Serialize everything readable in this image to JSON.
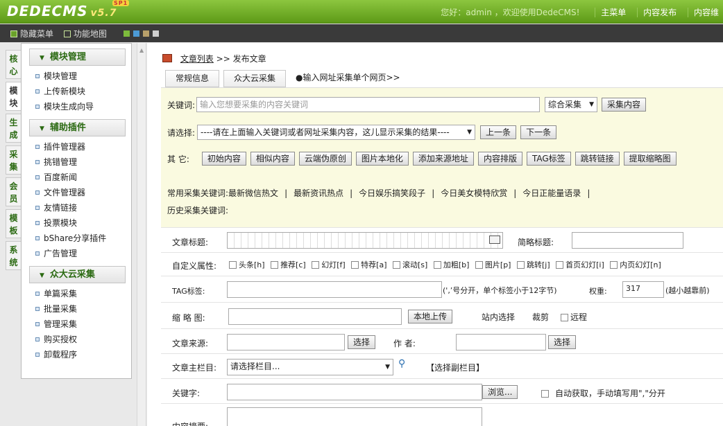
{
  "header": {
    "logo": "DEDECMS",
    "version": "v5.7",
    "sp": "SP1",
    "welcome": "您好：admin ，欢迎使用DedeCMS!",
    "menu": [
      "主菜单",
      "内容发布",
      "内容维"
    ]
  },
  "toolbar": {
    "hide_menu": "隐藏菜单",
    "func_map": "功能地图",
    "swatches": [
      "#7dbb3c",
      "#4c9ad6",
      "#b8a06a",
      "#cfcfcf"
    ]
  },
  "vtabs": [
    "核心",
    "模块",
    "生成",
    "采集",
    "会员",
    "模板",
    "系统"
  ],
  "sidebar": {
    "sections": [
      {
        "title": "模块管理",
        "items": [
          "模块管理",
          "上传新模块",
          "模块生成向导"
        ]
      },
      {
        "title": "辅助插件",
        "items": [
          "插件管理器",
          "挑错管理",
          "百度新闻",
          "文件管理器",
          "友情链接",
          "投票模块",
          "bShare分享插件",
          "广告管理"
        ]
      },
      {
        "title": "众大云采集",
        "items": [
          "单篇采集",
          "批量采集",
          "管理采集",
          "购买授权",
          "卸载程序"
        ]
      }
    ]
  },
  "main": {
    "crumb_link": "文章列表",
    "crumb_rest": ">> 发布文章",
    "tabs": [
      "常规信息",
      "众大云采集"
    ],
    "tab_link": "●输入网址采集单个网页>>",
    "collect": {
      "kw_label": "关键词:",
      "kw_placeholder": "输入您想要采集的内容关键词",
      "mode": "综合采集",
      "collect_btn": "采集内容",
      "pick_label": "请选择:",
      "pick_value": "----请在上面输入关键词或者网址采集内容，这儿显示采集的结果----",
      "prev": "上一条",
      "next": "下一条",
      "other_label": "其  它:",
      "other_btns": [
        "初始内容",
        "相似内容",
        "云端伪原创",
        "图片本地化",
        "添加来源地址",
        "内容排版",
        "TAG标签",
        "跳转链接",
        "提取缩略图"
      ],
      "common_label": "常用采集关键词:",
      "common_kws": [
        "最新微信热文",
        "最新资讯热点",
        "今日娱乐搞笑段子",
        "今日美女模特欣赏",
        "今日正能量语录"
      ],
      "history_label": "历史采集关键词:"
    },
    "form": {
      "title_label": "文章标题:",
      "short_title_label": "简略标题:",
      "attr_label": "自定义属性:",
      "attrs": [
        "头条[h]",
        "推荐[c]",
        "幻灯[f]",
        "特荐[a]",
        "滚动[s]",
        "加粗[b]",
        "图片[p]",
        "跳转[j]",
        "首页幻灯[i]",
        "内页幻灯[n]"
      ],
      "tag_label": "TAG标签:",
      "tag_hint": "(',’号分开，单个标签小于12字节)",
      "weight_label": "权重:",
      "weight_value": "317",
      "weight_hint": "(越小越靠前)",
      "thumb_label": "缩 略 图:",
      "upload_btn": "本地上传",
      "site_pick": "站内选择",
      "crop": "裁剪",
      "remote": "远程",
      "source_label": "文章来源:",
      "select_btn": "选择",
      "author_label": "作  者:",
      "select_btn2": "选择",
      "column_label": "文章主栏目:",
      "column_value": "请选择栏目...",
      "sub_column": "【选择副栏目】",
      "keyword_label": "关键字:",
      "browse": "浏览...",
      "auto_fetch": "自动获取，手动填写用\",\"分开",
      "summary_label": "内容摘要:"
    }
  }
}
